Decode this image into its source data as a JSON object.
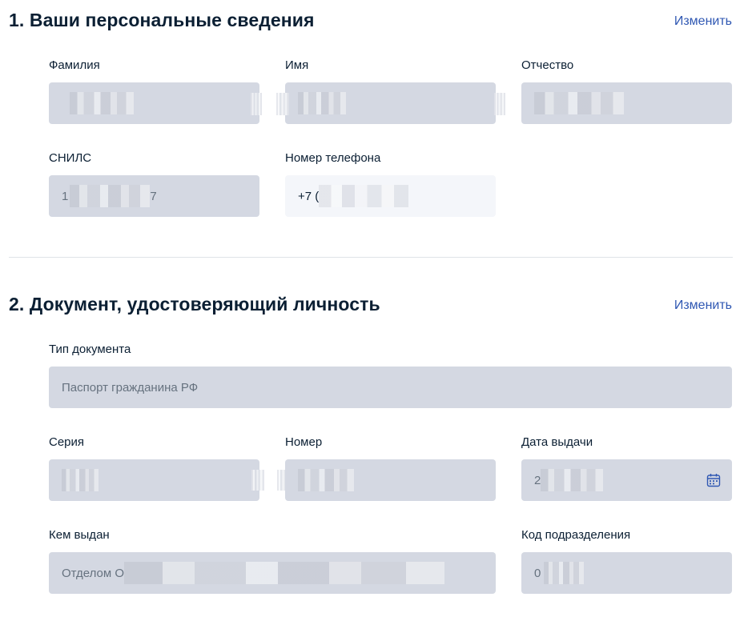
{
  "section1": {
    "title": "1. Ваши персональные сведения",
    "edit_label": "Изменить",
    "fields": {
      "surname": {
        "label": "Фамилия",
        "value": ""
      },
      "name": {
        "label": "Имя",
        "value": ""
      },
      "patronymic": {
        "label": "Отчество",
        "value": ""
      },
      "snils": {
        "label": "СНИЛС",
        "value_prefix": "1",
        "value_suffix": "7"
      },
      "phone": {
        "label": "Номер телефона",
        "value_prefix": "+7 ("
      }
    }
  },
  "section2": {
    "title": "2. Документ, удостоверяющий личность",
    "edit_label": "Изменить",
    "fields": {
      "doc_type": {
        "label": "Тип документа",
        "value": "Паспорт гражданина РФ"
      },
      "series": {
        "label": "Серия",
        "value": ""
      },
      "number": {
        "label": "Номер",
        "value": ""
      },
      "issue_date": {
        "label": "Дата выдачи",
        "value_prefix": "2"
      },
      "issued_by": {
        "label": "Кем выдан",
        "value_prefix": "Отделом О"
      },
      "division_code": {
        "label": "Код подразделения",
        "value_prefix": "0"
      }
    }
  },
  "colors": {
    "link": "#3058b3",
    "readonly_field": "#d4d8e2",
    "editable_field": "#f4f6fa",
    "text": "#0b1f33",
    "muted_text": "#66727f"
  },
  "icons": {
    "issue_date_picker": "calendar-icon"
  }
}
